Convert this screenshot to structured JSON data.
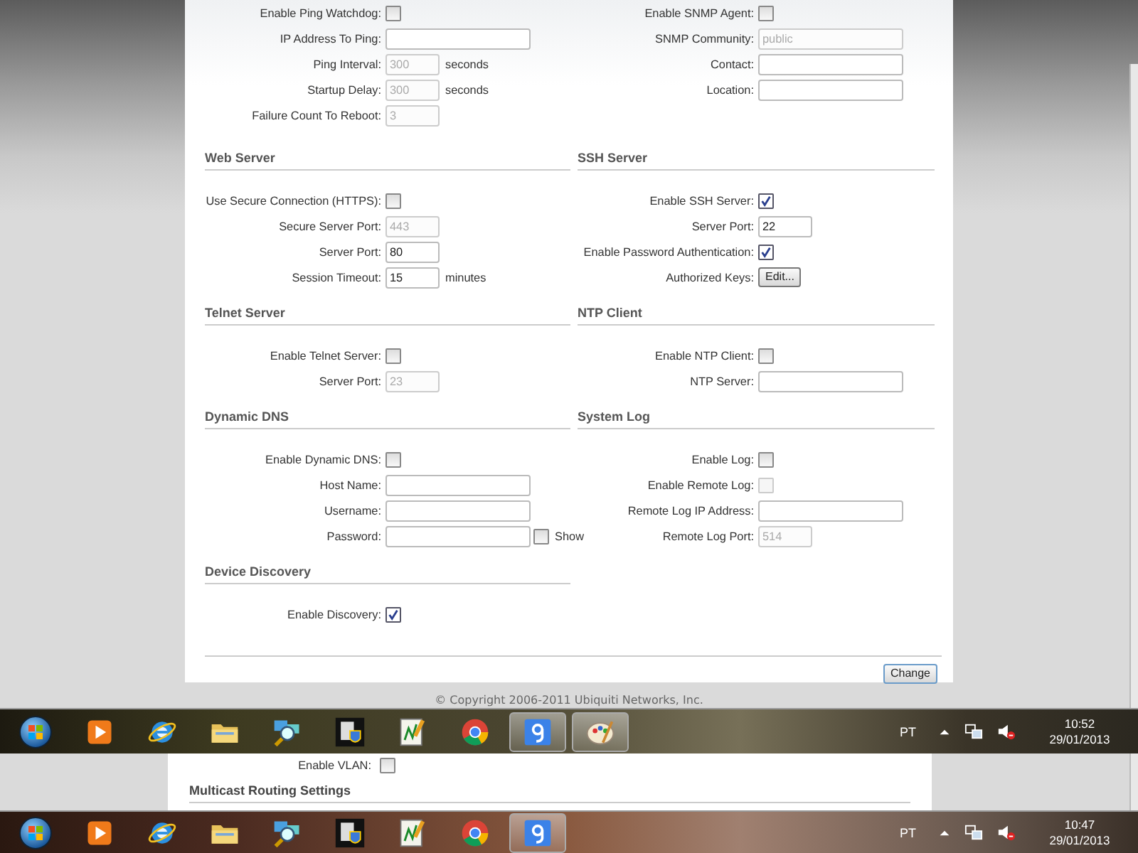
{
  "sections": [
    [
      {
        "rows": [
          {
            "kind": "checkbox",
            "label": "Enable Ping Watchdog:",
            "checked": false,
            "disabled": false
          },
          {
            "kind": "field",
            "label": "IP Address To Ping:"
          },
          {
            "kind": "short-field",
            "label": "Ping Interval:",
            "value": "300",
            "suffix": "seconds",
            "disabled": true
          },
          {
            "kind": "short-field",
            "label": "Startup Delay:",
            "value": "300",
            "suffix": "seconds",
            "disabled": true
          },
          {
            "kind": "short-field",
            "label": "Failure Count To Reboot:",
            "value": "3",
            "disabled": true
          }
        ]
      },
      {
        "rows": [
          {
            "kind": "checkbox",
            "label": "Enable SNMP Agent:",
            "checked": false,
            "disabled": false
          },
          {
            "kind": "field",
            "label": "SNMP Community:",
            "value": "public",
            "disabled": true
          },
          {
            "kind": "field",
            "label": "Contact:"
          },
          {
            "kind": "field",
            "label": "Location:"
          }
        ]
      }
    ],
    [
      {
        "title": "Web Server",
        "rows": [
          {
            "kind": "checkbox",
            "label": "Use Secure Connection (HTTPS):",
            "checked": false,
            "disabled": false
          },
          {
            "kind": "short-field",
            "label": "Secure Server Port:",
            "value": "443",
            "disabled": true
          },
          {
            "kind": "short-field",
            "label": "Server Port:",
            "value": "80",
            "disabled": false
          },
          {
            "kind": "short-field",
            "label": "Session Timeout:",
            "value": "15",
            "suffix": "minutes",
            "disabled": false
          }
        ]
      },
      {
        "title": "SSH Server",
        "rows": [
          {
            "kind": "checkbox",
            "label": "Enable SSH Server:",
            "checked": true,
            "disabled": false
          },
          {
            "kind": "short-field",
            "label": "Server Port:",
            "value": "22",
            "disabled": false
          },
          {
            "kind": "checkbox",
            "label": "Enable Password Authentication:",
            "checked": true,
            "disabled": false
          },
          {
            "kind": "button",
            "label": "Authorized Keys:",
            "button": "Edit..."
          }
        ]
      }
    ],
    [
      {
        "title": "Telnet Server",
        "rows": [
          {
            "kind": "checkbox",
            "label": "Enable Telnet Server:",
            "checked": false,
            "disabled": false
          },
          {
            "kind": "short-field",
            "label": "Server Port:",
            "value": "23",
            "disabled": true
          }
        ]
      },
      {
        "title": "NTP Client",
        "rows": [
          {
            "kind": "checkbox",
            "label": "Enable NTP Client:",
            "checked": false,
            "disabled": false
          },
          {
            "kind": "field",
            "label": "NTP Server:"
          }
        ]
      }
    ],
    [
      {
        "title": "Dynamic DNS",
        "rows": [
          {
            "kind": "checkbox",
            "label": "Enable Dynamic DNS:",
            "checked": false,
            "disabled": false
          },
          {
            "kind": "field",
            "label": "Host Name:"
          },
          {
            "kind": "field",
            "label": "Username:"
          },
          {
            "kind": "password",
            "label": "Password:",
            "show": {
              "label": "Show",
              "checked": false
            }
          }
        ]
      },
      {
        "title": "System Log",
        "rows": [
          {
            "kind": "checkbox",
            "label": "Enable Log:",
            "checked": false,
            "disabled": false
          },
          {
            "kind": "checkbox",
            "label": "Enable Remote Log:",
            "checked": false,
            "disabled": true
          },
          {
            "kind": "field",
            "label": "Remote Log IP Address:"
          },
          {
            "kind": "short-field",
            "label": "Remote Log Port:",
            "value": "514",
            "disabled": true
          }
        ]
      }
    ],
    [
      {
        "title": "Device Discovery",
        "rows": [
          {
            "kind": "checkbox",
            "label": "Enable Discovery:",
            "checked": true,
            "disabled": false
          }
        ]
      }
    ]
  ],
  "submit": "Change",
  "copyright": "© Copyright 2006-2011 Ubiquiti Networks, Inc.",
  "taskbars": [
    {
      "items": [
        {
          "kind": "player",
          "active": false
        },
        {
          "kind": "ie",
          "active": false
        },
        {
          "kind": "folder",
          "active": false
        },
        {
          "kind": "network",
          "active": false
        },
        {
          "kind": "shield",
          "active": false
        },
        {
          "kind": "editor",
          "active": false
        },
        {
          "kind": "chrome",
          "active": false
        },
        {
          "kind": "g",
          "active": true
        },
        {
          "kind": "palette",
          "active": true
        }
      ],
      "language": "PT",
      "time": "10:52",
      "date": "29/01/2013"
    }
  ],
  "behind": {
    "vlan_label": "Enable VLAN:",
    "vlan_checked": false,
    "heading": "Multicast Routing Settings"
  },
  "taskbars_below": [
    {
      "items": [
        {
          "kind": "player",
          "active": false
        },
        {
          "kind": "ie",
          "active": false
        },
        {
          "kind": "folder",
          "active": false
        },
        {
          "kind": "network",
          "active": false
        },
        {
          "kind": "shield",
          "active": false
        },
        {
          "kind": "editor",
          "active": false
        },
        {
          "kind": "chrome",
          "active": false
        },
        {
          "kind": "g",
          "active": true
        }
      ],
      "language": "PT",
      "time": "10:47",
      "date": "29/01/2013"
    }
  ]
}
